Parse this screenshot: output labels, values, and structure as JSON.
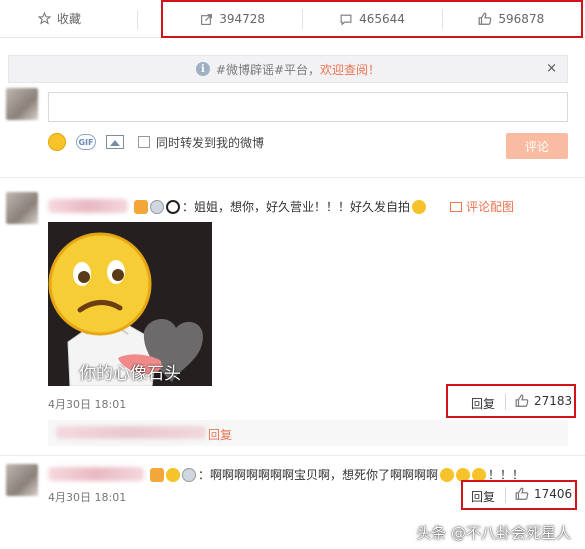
{
  "topbar": {
    "collect_label": "收藏",
    "forward_count": "394728",
    "comment_count": "465644",
    "like_count": "596878"
  },
  "notice": {
    "prefix": "#微博辟谣#平台，",
    "link_text": "欢迎查阅！",
    "close": "×"
  },
  "composer": {
    "gif_label": "GIF",
    "forward_checkbox_label": "同时转发到我的微博",
    "submit_label": "评论"
  },
  "comments": [
    {
      "text": "：姐姐，想你，好久营业！！！好久发自拍",
      "pic_link": "评论配图",
      "image_caption": "你的心像石头",
      "time": "4月30日 18:01",
      "reply_label": "回复",
      "likes": "27183",
      "subreply_label": "回复"
    },
    {
      "text": "：啊啊啊啊啊啊啊宝贝啊，想死你了啊啊啊啊",
      "trailing": "！！！",
      "time": "4月30日 18:01",
      "reply_label": "回复",
      "likes": "17406"
    }
  ],
  "watermark": "头条 @不八卦会死星人",
  "colors": {
    "highlight_box": "#d0141b",
    "link_orange": "#eb7350",
    "button_disabled": "#fabba3"
  }
}
